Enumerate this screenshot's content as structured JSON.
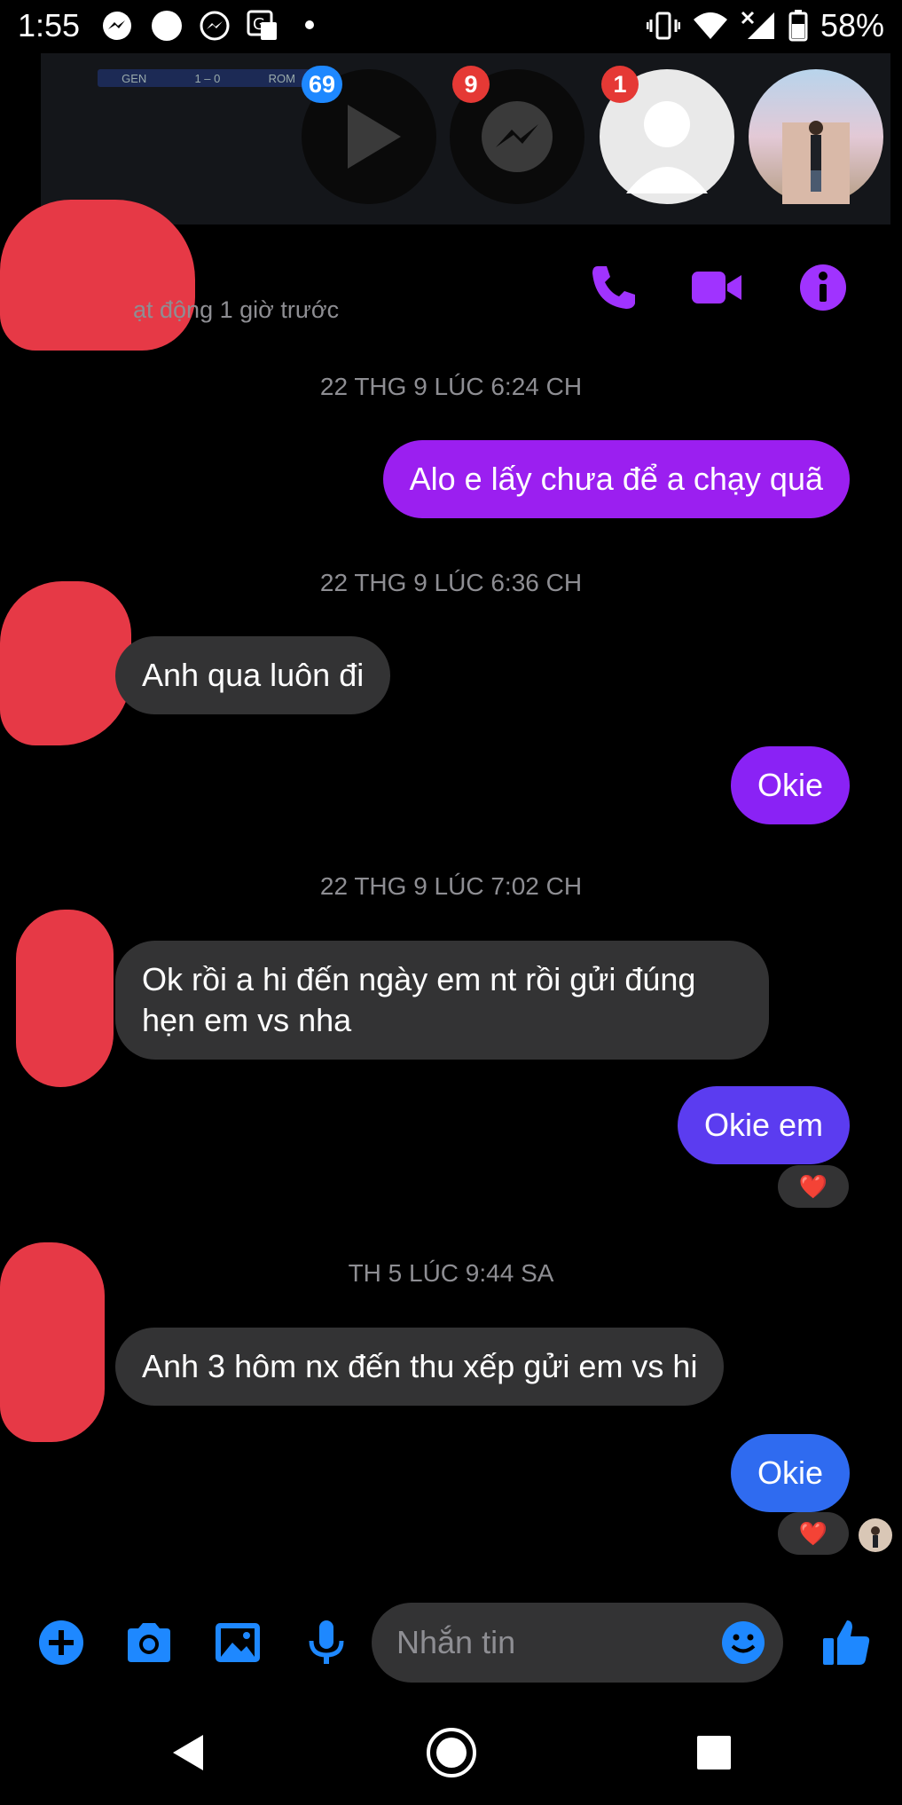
{
  "status_bar": {
    "time": "1:55",
    "battery": "58%",
    "icons": [
      "messenger-icon",
      "circle-icon",
      "messenger-outline-icon",
      "translate-icon",
      "dot-icon",
      "vibrate-icon",
      "wifi-icon",
      "signal-icon",
      "battery-icon"
    ]
  },
  "chat_heads": {
    "scoreboard": [
      "GEN",
      "1 – 0",
      "ROM"
    ],
    "badges": {
      "video": "69",
      "messenger": "9",
      "contact": "1"
    }
  },
  "header": {
    "active_status": "ạt động 1 giờ trước",
    "accent": "#a033ff"
  },
  "messages": [
    {
      "type": "timestamp",
      "text": "22 THG 9 LÚC 6:24 CH"
    },
    {
      "type": "outgoing",
      "text": "Alo e lấy chưa để a chạy quã",
      "color": "#9b1ff0"
    },
    {
      "type": "timestamp",
      "text": "22 THG 9 LÚC 6:36 CH"
    },
    {
      "type": "incoming",
      "text": "Anh qua luôn đi"
    },
    {
      "type": "outgoing",
      "text": "Okie",
      "color": "#8a22f5"
    },
    {
      "type": "timestamp",
      "text": "22 THG 9 LÚC 7:02 CH"
    },
    {
      "type": "incoming",
      "text": "Ok rồi a hi đến ngày em nt rồi gửi đúng hẹn em vs nha"
    },
    {
      "type": "outgoing",
      "text": "Okie em",
      "color": "#5b3cf0",
      "reaction": "❤️"
    },
    {
      "type": "timestamp",
      "text": "TH 5 LÚC 9:44 SA"
    },
    {
      "type": "incoming",
      "text": "Anh 3 hôm nx đến thu xếp gửi em vs hi"
    },
    {
      "type": "outgoing",
      "text": "Okie",
      "color": "#2f6bf0",
      "reaction": "❤️"
    }
  ],
  "composer": {
    "placeholder": "Nhắn tin",
    "accent": "#1e88ff"
  }
}
